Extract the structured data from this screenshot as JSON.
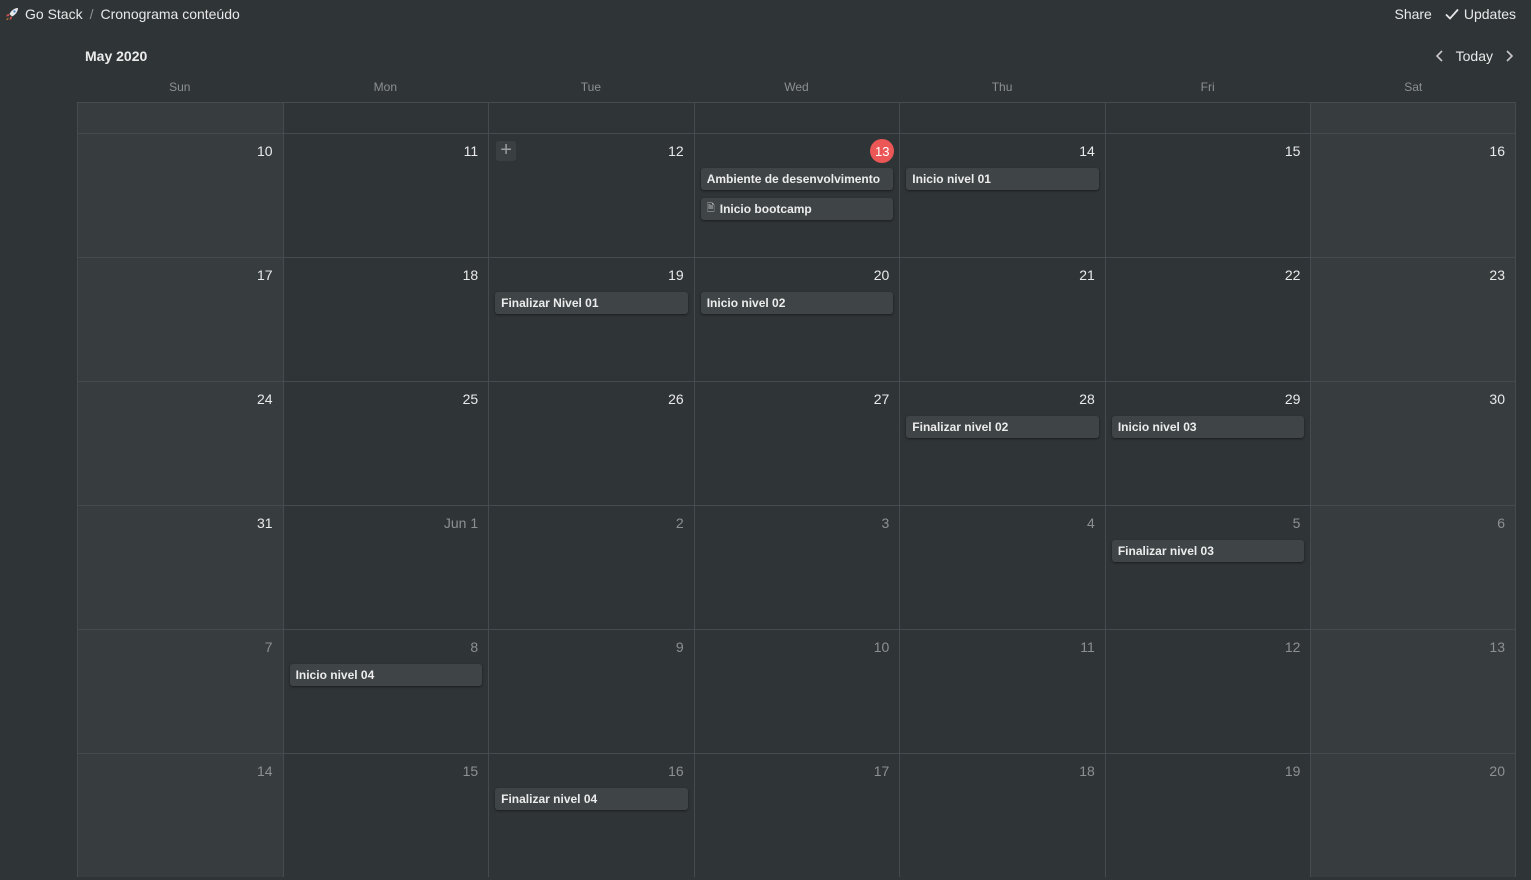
{
  "breadcrumb": {
    "workspace": "Go Stack",
    "separator": "/",
    "page": "Cronograma conteúdo"
  },
  "top_actions": {
    "share": "Share",
    "updates": "Updates"
  },
  "calendar": {
    "month_label": "May 2020",
    "today_button": "Today",
    "weekdays": [
      "Sun",
      "Mon",
      "Tue",
      "Wed",
      "Thu",
      "Fri",
      "Sat"
    ],
    "weeks": [
      {
        "days": [
          {
            "label": "10"
          },
          {
            "label": "11"
          },
          {
            "label": "12",
            "add_button": "+"
          },
          {
            "label": "13",
            "today": true,
            "events": [
              {
                "title": "Ambiente de desenvolvimento"
              },
              {
                "title": "Inicio bootcamp",
                "icon": "page-icon"
              }
            ]
          },
          {
            "label": "14",
            "events": [
              {
                "title": "Inicio nivel 01"
              }
            ]
          },
          {
            "label": "15"
          },
          {
            "label": "16"
          }
        ]
      },
      {
        "days": [
          {
            "label": "17"
          },
          {
            "label": "18"
          },
          {
            "label": "19",
            "events": [
              {
                "title": "Finalizar Nivel 01"
              }
            ]
          },
          {
            "label": "20",
            "events": [
              {
                "title": "Inicio nivel 02"
              }
            ]
          },
          {
            "label": "21"
          },
          {
            "label": "22"
          },
          {
            "label": "23"
          }
        ]
      },
      {
        "days": [
          {
            "label": "24"
          },
          {
            "label": "25"
          },
          {
            "label": "26"
          },
          {
            "label": "27"
          },
          {
            "label": "28",
            "events": [
              {
                "title": "Finalizar nivel 02"
              }
            ]
          },
          {
            "label": "29",
            "events": [
              {
                "title": "Inicio nivel 03"
              }
            ]
          },
          {
            "label": "30"
          }
        ]
      },
      {
        "days": [
          {
            "label": "31"
          },
          {
            "label": "Jun 1",
            "muted": true
          },
          {
            "label": "2",
            "muted": true
          },
          {
            "label": "3",
            "muted": true
          },
          {
            "label": "4",
            "muted": true
          },
          {
            "label": "5",
            "muted": true,
            "events": [
              {
                "title": "Finalizar nivel 03"
              }
            ]
          },
          {
            "label": "6",
            "muted": true
          }
        ]
      },
      {
        "days": [
          {
            "label": "7",
            "muted": true
          },
          {
            "label": "8",
            "muted": true,
            "events": [
              {
                "title": "Inicio nivel 04"
              }
            ]
          },
          {
            "label": "9",
            "muted": true
          },
          {
            "label": "10",
            "muted": true
          },
          {
            "label": "11",
            "muted": true
          },
          {
            "label": "12",
            "muted": true
          },
          {
            "label": "13",
            "muted": true
          }
        ]
      },
      {
        "days": [
          {
            "label": "14",
            "muted": true
          },
          {
            "label": "15",
            "muted": true
          },
          {
            "label": "16",
            "muted": true,
            "events": [
              {
                "title": "Finalizar nivel 04"
              }
            ]
          },
          {
            "label": "17",
            "muted": true
          },
          {
            "label": "18",
            "muted": true
          },
          {
            "label": "19",
            "muted": true
          },
          {
            "label": "20",
            "muted": true
          }
        ]
      }
    ]
  },
  "colors": {
    "background": "#2f3437",
    "weekend": "#373c3f",
    "event": "#3f4447",
    "today_badge": "#eb5757"
  }
}
